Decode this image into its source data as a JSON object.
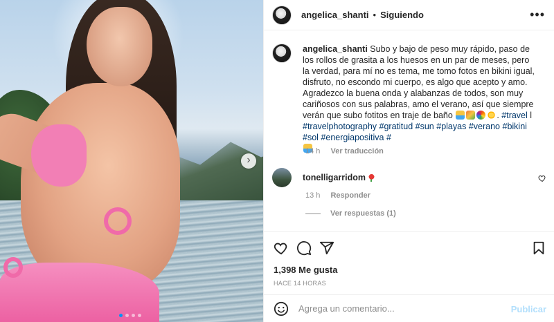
{
  "post": {
    "username": "angelica_shanti",
    "separator": "•",
    "follow_status": "Siguiendo",
    "more_icon": "more-dots-icon",
    "carousel": {
      "current": 1,
      "total": 4
    }
  },
  "caption": {
    "username": "angelica_shanti",
    "text_1": "Subo y bajo de peso muy rápido, paso de los rollos de grasita a los huesos en un par de meses, pero la verdad, para mí no es tema, me tomo fotos en bikini igual, disfruto, no escondo mi cuerpo, es algo que acepto y amo. Agradezco la buena onda y alabanzas de todos, son muy cariñosos con sus palabras, amo el verano, así que siempre verán que subo fotitos en traje de baño",
    "text_2": ". ",
    "tag_travel": "#travel",
    "pipe": " l ",
    "tag_travelphotography": "#travelphotography",
    "tag_gratitud": "#gratitud",
    "tag_sun": "#sun",
    "tag_playas": "#playas",
    "tag_verano": "#verano",
    "tag_bikini": "#bikini",
    "tag_sol": "#sol",
    "tag_energiapositiva": "#energiapositiva",
    "tag_hash": "#",
    "time": "14 h",
    "translation": "Ver traducción"
  },
  "comment": {
    "username": "tonelligarridom",
    "time": "13 h",
    "reply": "Responder",
    "view_replies": "Ver respuestas (1)"
  },
  "stats": {
    "likes": "1,398 Me gusta",
    "ago": "HACE 14 HORAS"
  },
  "composer": {
    "placeholder": "Agrega un comentario...",
    "publish": "Publicar"
  }
}
